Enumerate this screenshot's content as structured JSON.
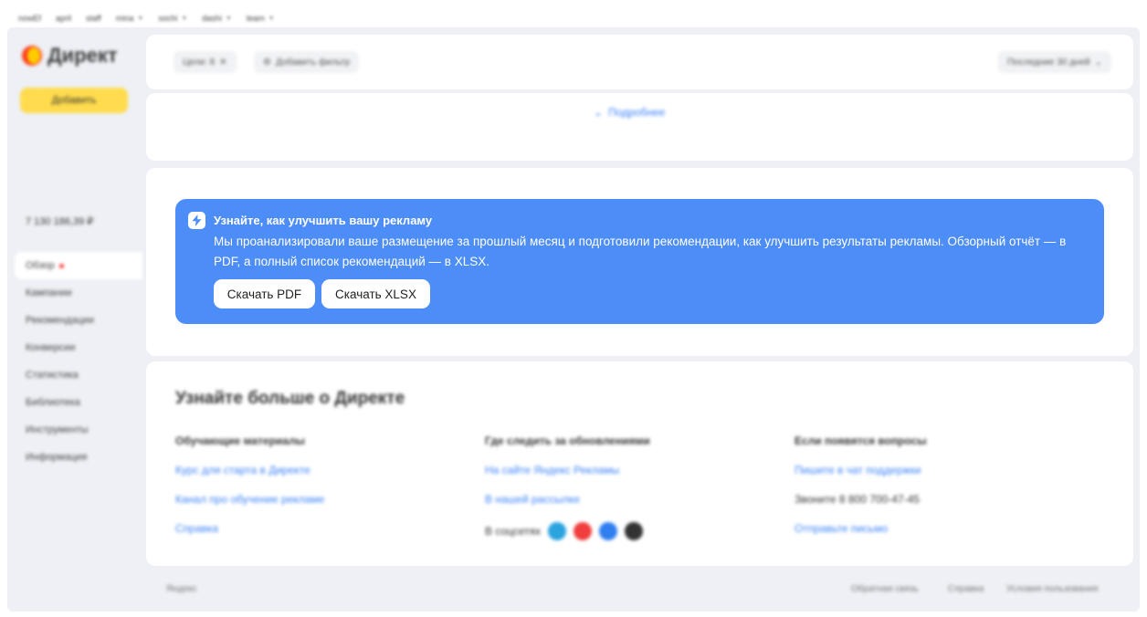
{
  "topbar": {
    "items": [
      {
        "label": "nowEf",
        "dropdown": false
      },
      {
        "label": "april",
        "dropdown": false
      },
      {
        "label": "staff",
        "dropdown": false
      },
      {
        "label": "mina",
        "dropdown": true
      },
      {
        "label": "sochi",
        "dropdown": true
      },
      {
        "label": "dashi",
        "dropdown": true
      },
      {
        "label": "team",
        "dropdown": true
      }
    ]
  },
  "sidebar": {
    "logo_text": "Директ",
    "add_button": "Добавить",
    "balance": "7 130 186,39 ₽",
    "nav": [
      {
        "label": "Обзор",
        "active": true,
        "badge": true
      },
      {
        "label": "Кампании",
        "active": false
      },
      {
        "label": "Рекомендации",
        "active": false
      },
      {
        "label": "Конверсии",
        "active": false
      },
      {
        "label": "Статистика",
        "active": false
      },
      {
        "label": "Библиотека",
        "active": false
      },
      {
        "label": "Инструменты",
        "active": false
      },
      {
        "label": "Информация",
        "active": false
      }
    ]
  },
  "filters": {
    "chip_label": "Цели: 8",
    "add_filter": "Добавить фильтр",
    "period": "Последние 30 дней"
  },
  "details": {
    "link": "Подробнее"
  },
  "recommendation": {
    "title": "Узнайте, как улучшить вашу рекламу",
    "text": "Мы проанализировали ваше размещение за прошлый месяц и подготовили рекомендации, как улучшить результаты рекламы. Обзорный отчёт — в PDF, а полный список рекомендаций — в XLSX.",
    "btn_pdf": "Скачать PDF",
    "btn_xlsx": "Скачать XLSX",
    "colors": {
      "banner": "#4d8df7",
      "button": "#ffffff"
    }
  },
  "learn_more": {
    "title": "Узнайте больше о Директе",
    "col1": {
      "heading": "Обучающие материалы",
      "links": [
        "Курс для старта в Директе",
        "Канал про обучение рекламе",
        "Справка"
      ]
    },
    "col2": {
      "heading": "Где следить за обновлениями",
      "links": [
        "На сайте Яндекс Рекламы",
        "В нашей рассылке"
      ],
      "social_label": "В соцсетях",
      "social_icons": [
        "telegram-icon",
        "youtube-icon",
        "vk-icon",
        "dzen-icon"
      ]
    },
    "col3": {
      "heading": "Если появятся вопросы",
      "link1": "Пишите в чат поддержки",
      "phone": "Звоните 8 800 700-47-45",
      "link2": "Отправьте письмо"
    }
  },
  "footer": {
    "left": "Яндекс",
    "links": [
      "Обратная связь",
      "Справка",
      "Условия пользования"
    ]
  }
}
